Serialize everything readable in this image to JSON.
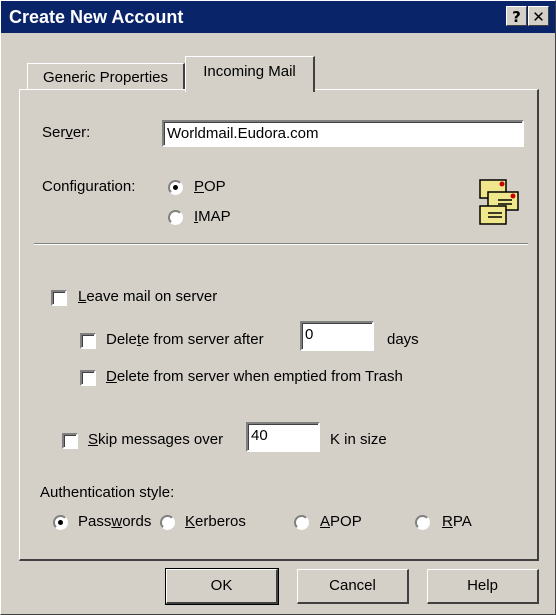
{
  "window": {
    "title": "Create New Account",
    "help_button": "?",
    "close_button": "✕"
  },
  "tabs": [
    {
      "label": "Generic Properties",
      "active": false
    },
    {
      "label": "Incoming Mail",
      "active": true
    }
  ],
  "server": {
    "label_pre": "Ser",
    "label_mn": "v",
    "label_post": "er:",
    "value": "Worldmail.Eudora.com"
  },
  "configuration": {
    "label": "Configuration:",
    "options": [
      {
        "mn": "P",
        "rest": "OP",
        "selected": true
      },
      {
        "mn": "I",
        "rest": "MAP",
        "selected": false
      }
    ]
  },
  "leave_mail": {
    "mn": "L",
    "rest": "eave mail on server",
    "checked": false
  },
  "delete_after": {
    "pre": "Dele",
    "mn": "t",
    "post": "e from server after",
    "value": "0",
    "units": "days",
    "checked": false
  },
  "delete_trash": {
    "mn": "D",
    "rest": "elete from server when emptied from Trash",
    "checked": false
  },
  "skip": {
    "mn": "S",
    "rest": "kip messages over",
    "value": "40",
    "units": "K in size",
    "checked": false
  },
  "auth": {
    "label": "Authentication style:",
    "options": [
      {
        "pre": "Pass",
        "mn": "w",
        "post": "ords",
        "selected": true
      },
      {
        "pre": "",
        "mn": "K",
        "post": "erberos",
        "selected": false
      },
      {
        "pre": "",
        "mn": "A",
        "post": "POP",
        "selected": false
      },
      {
        "pre": "",
        "mn": "R",
        "post": "PA",
        "selected": false
      }
    ]
  },
  "buttons": {
    "ok": "OK",
    "cancel": "Cancel",
    "help": "Help"
  },
  "icons": {
    "mail_accounts": "mail-accounts-icon"
  }
}
